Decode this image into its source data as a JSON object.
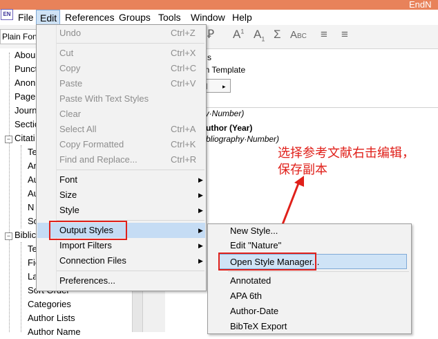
{
  "app": {
    "icon": "EN",
    "title": "EndN"
  },
  "menubar": [
    "File",
    "Edit",
    "References",
    "Groups",
    "Tools",
    "Window",
    "Help"
  ],
  "toolbar": {
    "font": "Plain Font"
  },
  "tree": {
    "items": [
      "Abou",
      "Punct",
      "Anon",
      "Page",
      "Journ",
      "Sectio",
      "Citati"
    ],
    "citation_children": [
      "Te",
      "Ar",
      "Au",
      "Au",
      "N",
      "So"
    ],
    "bibliography": "Biblic",
    "bib_children": [
      "Te",
      "Fie",
      "La",
      "Sort Order",
      "Categories",
      "Author Lists",
      "Author Name"
    ]
  },
  "right_panel": {
    "line1": "s",
    "line2": "on Template",
    "button": "ld",
    "line3": "hy·Number)",
    "line4": "uthor (Year)",
    "line5": "bliography·Number)"
  },
  "annotation": [
    "选择参考文献右击编辑，",
    "保存副本"
  ],
  "edit_menu": [
    {
      "label": "Undo",
      "shortcut": "Ctrl+Z",
      "disabled": true
    },
    {
      "label": "Cut",
      "shortcut": "Ctrl+X",
      "disabled": true
    },
    {
      "label": "Copy",
      "shortcut": "Ctrl+C",
      "disabled": true
    },
    {
      "label": "Paste",
      "shortcut": "Ctrl+V",
      "disabled": true
    },
    {
      "label": "Paste With Text Styles",
      "shortcut": "",
      "disabled": true
    },
    {
      "label": "Clear",
      "shortcut": "",
      "disabled": true
    },
    {
      "label": "Select All",
      "shortcut": "Ctrl+A",
      "disabled": true
    },
    {
      "label": "Copy Formatted",
      "shortcut": "Ctrl+K",
      "disabled": true
    },
    {
      "label": "Find and Replace...",
      "shortcut": "Ctrl+R",
      "disabled": true
    },
    {
      "label": "Font",
      "submenu": true
    },
    {
      "label": "Size",
      "submenu": true
    },
    {
      "label": "Style",
      "submenu": true
    },
    {
      "label": "Output Styles",
      "submenu": true
    },
    {
      "label": "Import Filters",
      "submenu": true
    },
    {
      "label": "Connection Files",
      "submenu": true
    },
    {
      "label": "Preferences..."
    }
  ],
  "output_styles_menu": [
    "New Style...",
    "Edit \"Nature\"",
    "Open Style Manager...",
    "Annotated",
    "APA 6th",
    "Author-Date",
    "BibTeX Export"
  ],
  "colors": {
    "titlebar": "#e8825a",
    "highlight": "#c5dcf4",
    "annotation": "#e0201a"
  }
}
